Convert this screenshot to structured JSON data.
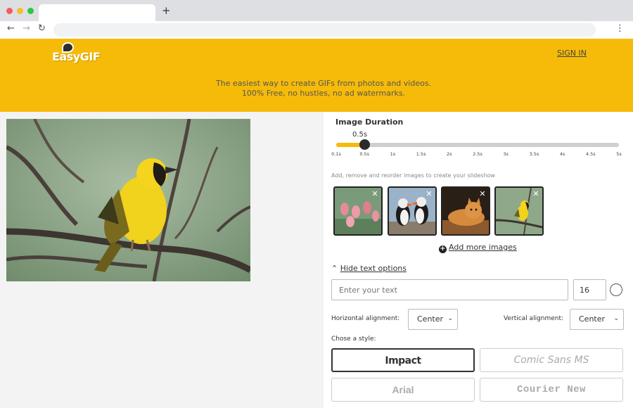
{
  "browser": {
    "new_tab_symbol": "+",
    "back_icon": "arrow-left-icon",
    "forward_icon": "arrow-right-icon",
    "reload_icon": "reload-icon",
    "menu_icon": "more-vert-icon"
  },
  "header": {
    "logo_text": "EasyGIF",
    "signin_label": "SIGN IN",
    "tagline_line1": "The easiest way to create GIFs from photos and videos.",
    "tagline_line2": "100% Free, no hustles, no ad watermarks."
  },
  "duration": {
    "title": "Image Duration",
    "current_label": "0.5s",
    "current_value": 0.5,
    "min": 0.1,
    "max": 5,
    "ticks": [
      "0.1s",
      "0.5s",
      "1s",
      "1.5s",
      "2s",
      "2.5s",
      "3s",
      "3.5s",
      "4s",
      "4.5s",
      "5s"
    ]
  },
  "slideshow": {
    "hint": "Add, remove and reorder images to create your slideshow",
    "thumbnails": [
      {
        "name": "flamingos",
        "close": "✕"
      },
      {
        "name": "puffins",
        "close": "✕"
      },
      {
        "name": "cat",
        "close": "✕"
      },
      {
        "name": "bird",
        "close": "✕"
      }
    ],
    "add_more_label": "Add more images"
  },
  "text_options": {
    "toggle_label": "Hide text options",
    "text_placeholder": "Enter your text",
    "font_size": "16",
    "horizontal_label": "Horizontal alignment:",
    "horizontal_value": "Center",
    "vertical_label": "Vertical alignment:",
    "vertical_value": "Center",
    "style_label": "Chose a style:",
    "styles": [
      "Impact",
      "Comic Sans MS",
      "Arial",
      "Courier New"
    ],
    "selected_style": "Impact"
  },
  "colors": {
    "brand_yellow": "#f6bb08",
    "dark": "#2b2b2b"
  }
}
